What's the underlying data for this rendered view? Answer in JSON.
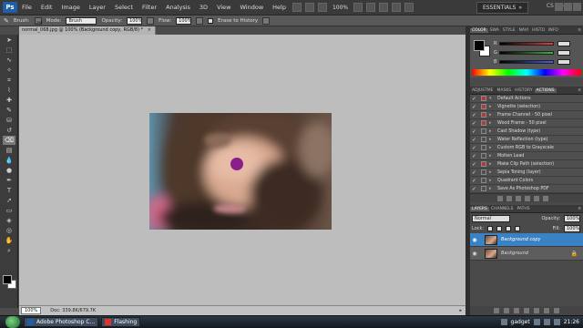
{
  "app": {
    "logo": "Ps",
    "menu": [
      "File",
      "Edit",
      "Image",
      "Layer",
      "Select",
      "Filter",
      "Analysis",
      "3D",
      "View",
      "Window",
      "Help"
    ],
    "zoom_menu": "100%",
    "workspace": "ESSENTIALS",
    "cs_live": "CS Live"
  },
  "options": {
    "brush_label": "Brush:",
    "brush_size": "200",
    "mode_label": "Mode:",
    "mode_value": "Brush",
    "opacity_label": "Opacity:",
    "opacity_value": "100%",
    "flow_label": "Flow:",
    "flow_value": "100%",
    "erase_label": "Erase to History"
  },
  "document": {
    "tab_title": "normal_068.jpg @ 100% (Background copy, RGB/8) *",
    "zoom": "100%",
    "doc_size": "Doc: 339.8K/679.7K"
  },
  "color_panel": {
    "tabs": [
      "COLOR",
      "SWA",
      "STYLE",
      "NAVI",
      "HISTO",
      "INFO"
    ],
    "channels": [
      {
        "label": "R",
        "value": "",
        "color": "#e04040"
      },
      {
        "label": "G",
        "value": "",
        "color": "#40b040"
      },
      {
        "label": "B",
        "value": "",
        "color": "#4060e0"
      }
    ]
  },
  "actions_panel": {
    "tabs": [
      "ADJUSTME",
      "MASKS",
      "HISTORY",
      "ACTIONS"
    ],
    "items": [
      {
        "name": "Default Actions",
        "check": "✓",
        "red": true,
        "folder": true
      },
      {
        "name": "Vignette (selection)",
        "check": "✓",
        "red": true
      },
      {
        "name": "Frame Channel - 50 pixel",
        "check": "✓",
        "red": true
      },
      {
        "name": "Wood Frame - 50 pixel",
        "check": "✓",
        "red": true
      },
      {
        "name": "Cast Shadow (type)",
        "check": "✓",
        "red": false
      },
      {
        "name": "Water Reflection (type)",
        "check": "✓",
        "red": false
      },
      {
        "name": "Custom RGB to Grayscale",
        "check": "✓",
        "red": false
      },
      {
        "name": "Molten Lead",
        "check": "✓",
        "red": false
      },
      {
        "name": "Make Clip Path (selection)",
        "check": "✓",
        "red": true
      },
      {
        "name": "Sepia Toning (layer)",
        "check": "✓",
        "red": false
      },
      {
        "name": "Quadrant Colors",
        "check": "✓",
        "red": false
      },
      {
        "name": "Save As Photoshop PDF",
        "check": "✓",
        "red": false
      }
    ]
  },
  "layers_panel": {
    "tabs": [
      "LAYERS",
      "CHANNELS",
      "PATHS"
    ],
    "blend_mode": "Normal",
    "opacity_label": "Opacity:",
    "opacity_value": "100%",
    "lock_label": "Lock:",
    "fill_label": "Fill:",
    "fill_value": "100%",
    "layers": [
      {
        "name": "Background copy",
        "selected": true,
        "locked": false
      },
      {
        "name": "Background",
        "selected": false,
        "locked": true
      }
    ]
  },
  "taskbar": {
    "tasks": [
      {
        "label": "Adobe Photoshop C...",
        "icon_color": "#1d5fa8"
      },
      {
        "label": "Flashing",
        "icon_color": "#d33"
      }
    ],
    "gadget_label": "gadget",
    "time": "21:26"
  }
}
